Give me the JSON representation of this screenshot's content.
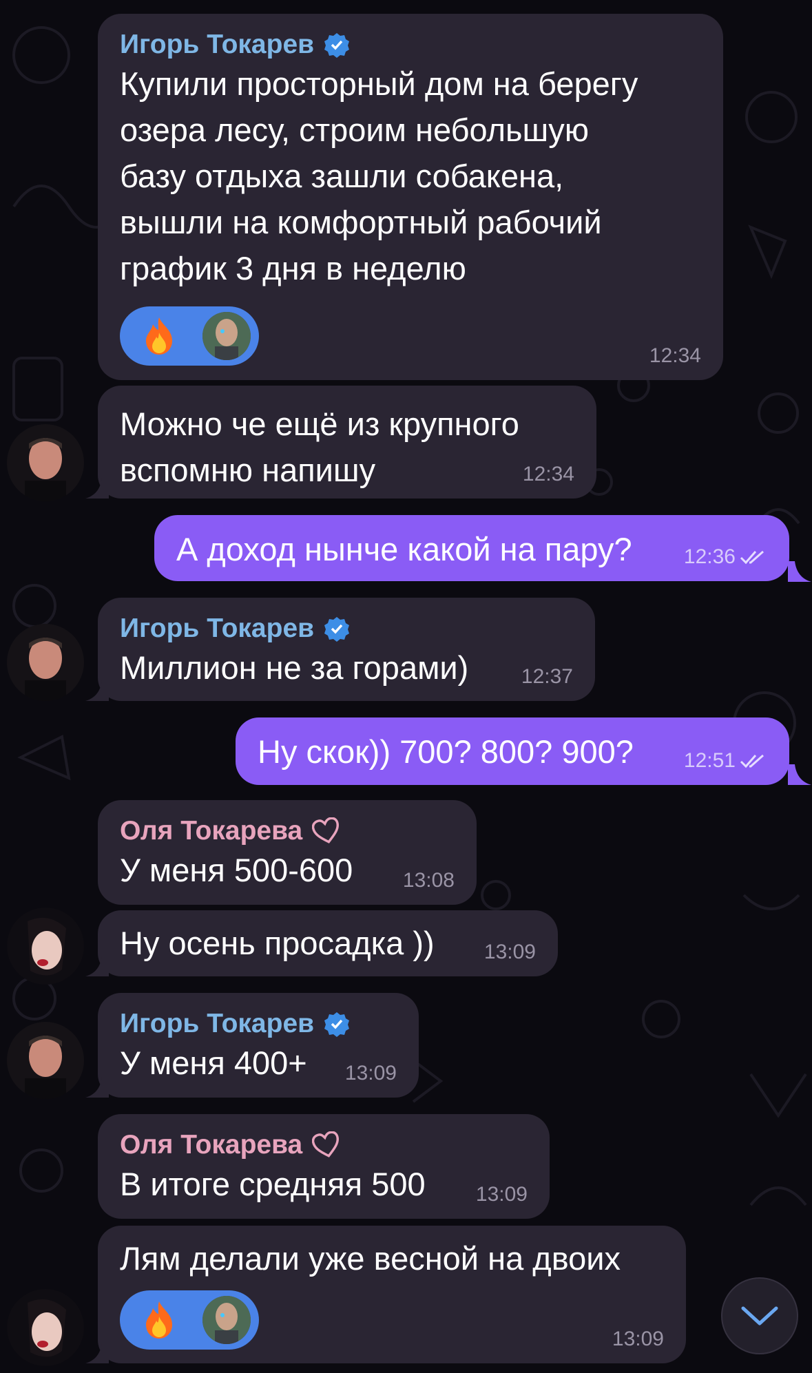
{
  "messages": [
    {
      "sender": "Игорь Токарев",
      "text": "Купили просторный дом на берегу\nозера лесу, строим небольшую\nбазу отдыха зашли собакена,\nвышли на комфортный рабочий\nграфик 3 дня в неделю",
      "time": "12:34",
      "reaction": "🔥"
    },
    {
      "text": "Можно че ещё из крупного\nвспомню напишу",
      "time": "12:34"
    },
    {
      "text": "А доход нынче какой на пару?",
      "time": "12:36"
    },
    {
      "sender": "Игорь Токарев",
      "text": "Миллион не за горами)",
      "time": "12:37"
    },
    {
      "text": "Ну скок)) 700? 800? 900?",
      "time": "12:51"
    },
    {
      "sender": "Оля Токарева",
      "text": "У меня 500-600",
      "time": "13:08"
    },
    {
      "text": "Ну осень просадка ))",
      "time": "13:09"
    },
    {
      "sender": "Игорь Токарев",
      "text": "У меня 400+",
      "time": "13:09"
    },
    {
      "sender": "Оля Токарева",
      "text": "В итоге средняя 500",
      "time": "13:09"
    },
    {
      "text": "Лям делали уже весной на двоих",
      "time": "13:09",
      "reaction": "🔥"
    }
  ],
  "colors": {
    "background": "#0b0a10",
    "incoming_bubble": "#2a2533",
    "outgoing_bubble": "#8a5cf5",
    "igor_name": "#7fb7e6",
    "olya_name": "#e8a4bd",
    "reaction_pill": "#4a83e8"
  },
  "icons": {
    "verified": "verified-badge-icon",
    "heart": "heart-outline-icon",
    "read": "double-check-icon",
    "scroll": "chevron-down-icon"
  }
}
